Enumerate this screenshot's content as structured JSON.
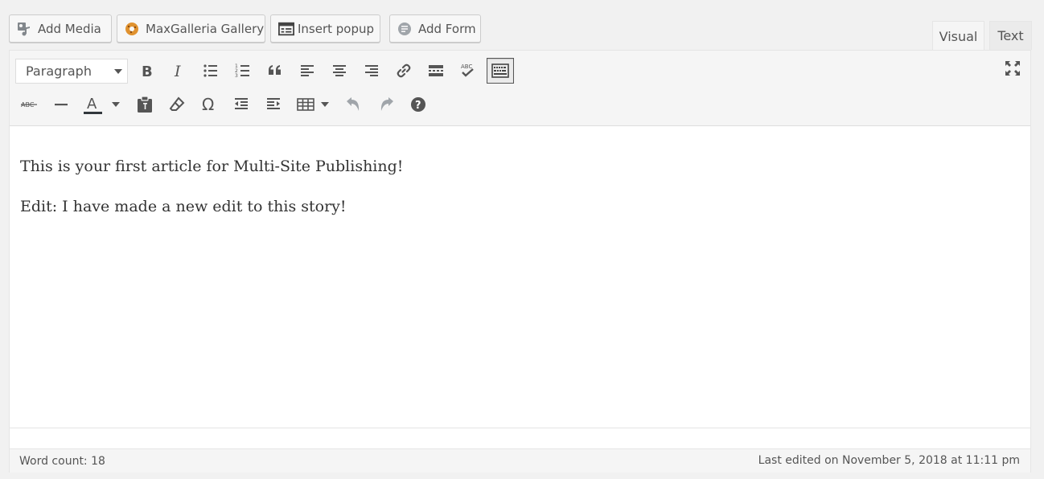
{
  "media_buttons": {
    "add_media": "Add Media",
    "maxgalleria": "MaxGalleria Gallery",
    "insert_popup": "Insert popup",
    "add_form": "Add Form"
  },
  "tabs": {
    "visual": "Visual",
    "text": "Text"
  },
  "toolbar": {
    "format_value": "Paragraph",
    "spellcheck_label": "ABC",
    "strike_label": "ABC",
    "text_color_label": "A"
  },
  "content": {
    "paragraphs": [
      "This is your first article for Multi-Site Publishing!",
      "Edit: I have made a new edit to this story!"
    ]
  },
  "status": {
    "word_count": "Word count: 18",
    "last_edited": "Last edited on November 5, 2018 at 11:11 pm"
  },
  "colors": {
    "text_color_bar": "#32373c",
    "gallery_icon": "#e0922f"
  }
}
